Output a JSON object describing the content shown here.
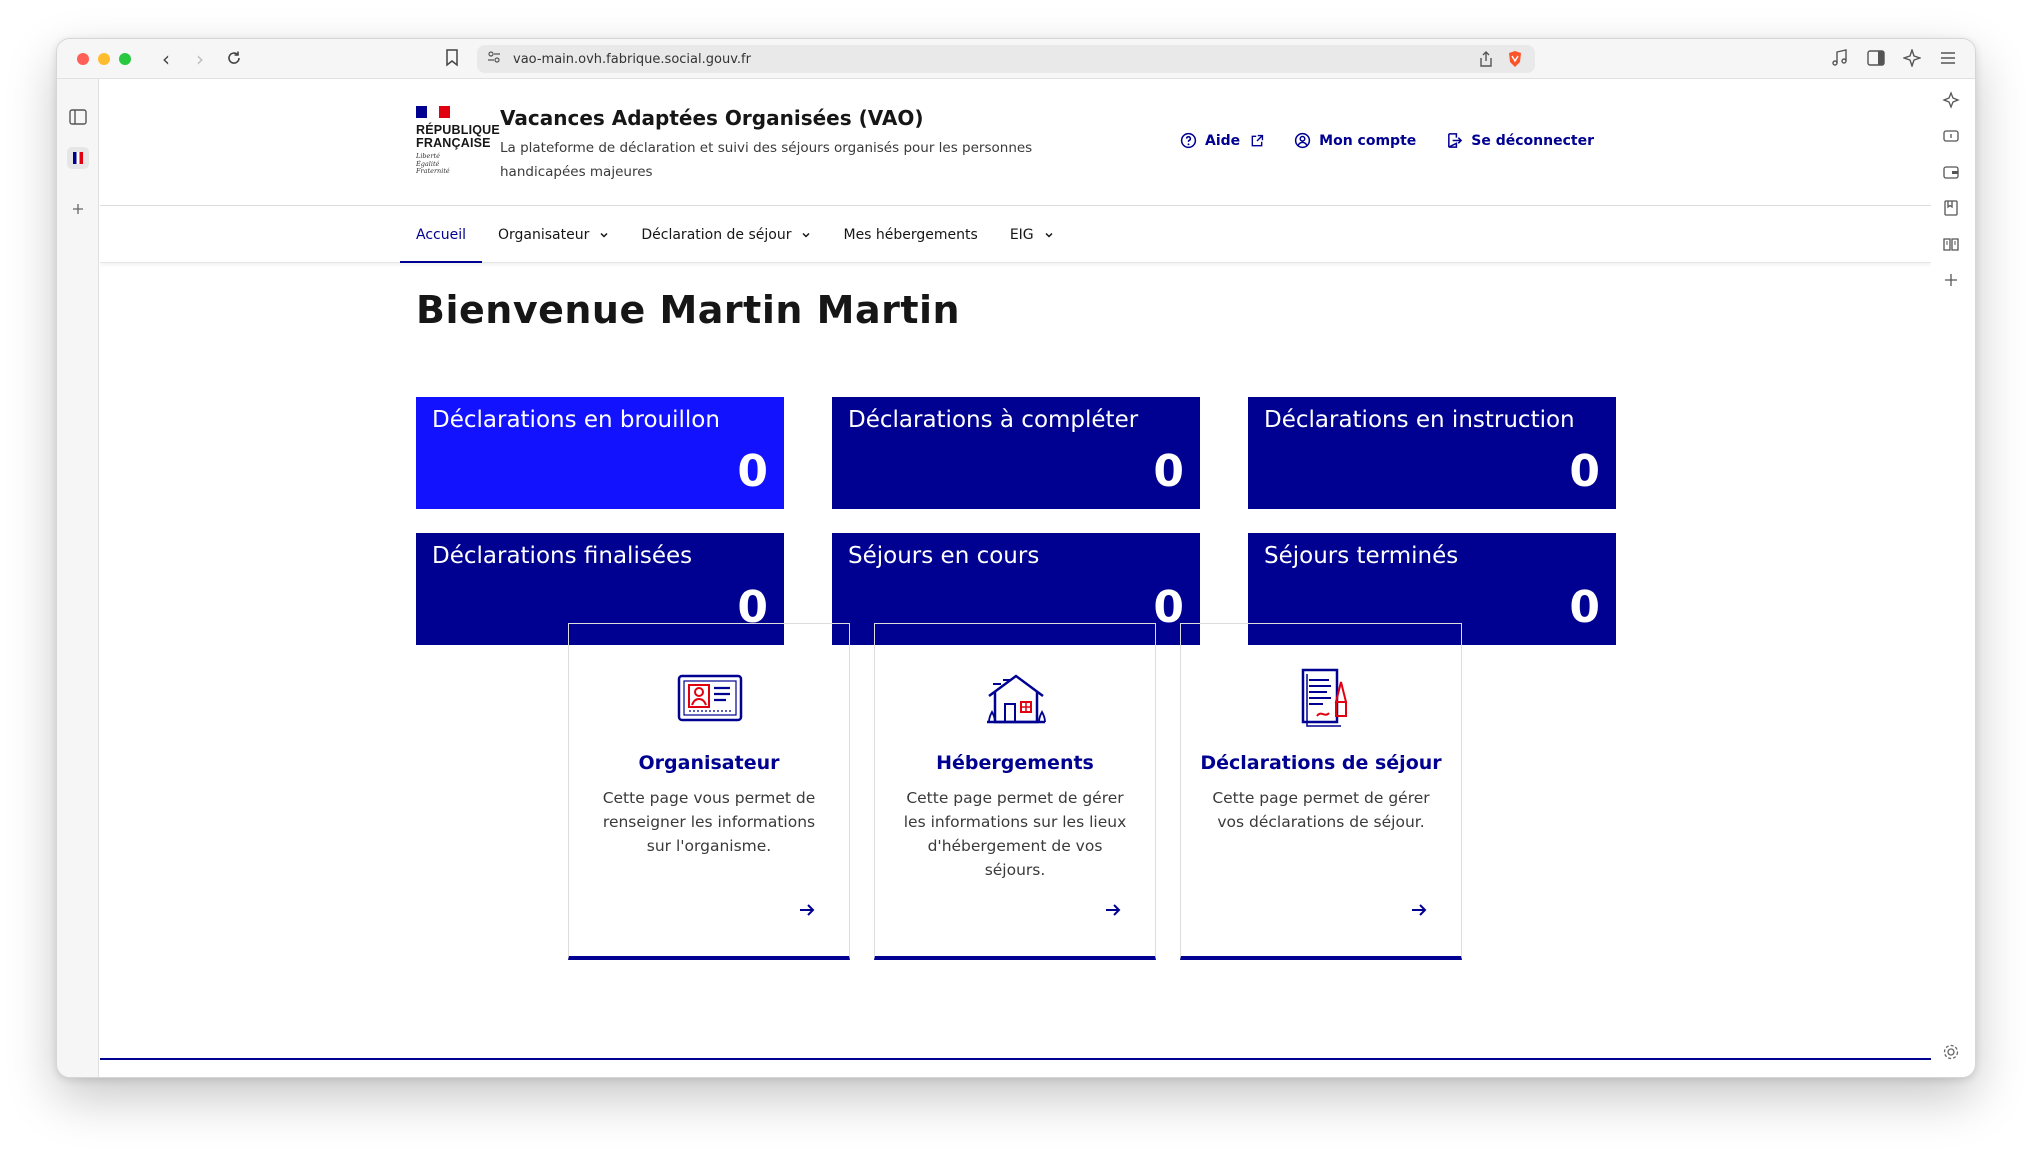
{
  "browser": {
    "url": "vao-main.ovh.fabrique.social.gouv.fr"
  },
  "header": {
    "logo": {
      "title_line1": "RÉPUBLIQUE",
      "title_line2": "FRANÇAISE",
      "motto_line1": "Liberté",
      "motto_line2": "Égalité",
      "motto_line3": "Fraternité"
    },
    "service_title": "Vacances Adaptées Organisées (VAO)",
    "service_tagline": "La plateforme de déclaration et suivi des séjours organisés pour les personnes handicapées majeures",
    "links": {
      "help": "Aide",
      "account": "Mon compte",
      "logout": "Se déconnecter"
    }
  },
  "nav": {
    "items": [
      {
        "label": "Accueil"
      },
      {
        "label": "Organisateur"
      },
      {
        "label": "Déclaration de séjour"
      },
      {
        "label": "Mes hébergements"
      },
      {
        "label": "EIG"
      }
    ]
  },
  "main": {
    "welcome": "Bienvenue Martin Martin",
    "stats": [
      {
        "label": "Déclarations en brouillon",
        "value": "0"
      },
      {
        "label": "Déclarations à compléter",
        "value": "0"
      },
      {
        "label": "Déclarations en instruction",
        "value": "0"
      },
      {
        "label": "Déclarations finalisées",
        "value": "0"
      },
      {
        "label": "Séjours en cours",
        "value": "0"
      },
      {
        "label": "Séjours terminés",
        "value": "0"
      }
    ],
    "cards": [
      {
        "title": "Organisateur",
        "description": "Cette page vous permet de renseigner les informations sur l'organisme.",
        "icon": "id-card-icon"
      },
      {
        "title": "Hébergements",
        "description": "Cette page permet de gérer les informations sur les lieux d'hébergement de vos séjours.",
        "icon": "house-icon"
      },
      {
        "title": "Déclarations de séjour",
        "description": "Cette page permet de gérer vos déclarations de séjour.",
        "icon": "document-icon"
      }
    ]
  },
  "colors": {
    "primary": "#000091",
    "draft_stat": "#1212ff",
    "accent_red": "#e1000f"
  }
}
